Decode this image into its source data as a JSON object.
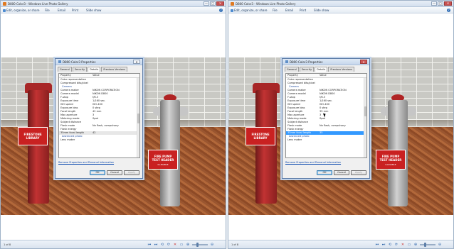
{
  "windows": [
    {
      "title": "D800 Color3 - Windows Live Photo Gallery",
      "menu": [
        "Edit, organize, or share",
        "File",
        "Email",
        "Print",
        "Slide show"
      ],
      "status_count": "1 of 8",
      "dialog": {
        "title": "D800 Color3 Properties",
        "tabs": [
          "General",
          "Security",
          "Details",
          "Previous Versions"
        ],
        "active_tab": "Details",
        "columns": [
          "Property",
          "Value"
        ],
        "rows": [
          {
            "p": "Color representation",
            "v": "",
            "type": "normal"
          },
          {
            "p": "Compressed bits/pixel",
            "v": "",
            "type": "normal"
          },
          {
            "p": "Camera",
            "v": "",
            "type": "section"
          },
          {
            "p": "Camera maker",
            "v": "NIKON CORPORATION",
            "type": "normal"
          },
          {
            "p": "Camera model",
            "v": "NIKON D800",
            "type": "normal"
          },
          {
            "p": "F-stop",
            "v": "f/6.3",
            "type": "normal"
          },
          {
            "p": "Exposure time",
            "v": "1/160 sec.",
            "type": "normal"
          },
          {
            "p": "ISO speed",
            "v": "ISO-400",
            "type": "normal"
          },
          {
            "p": "Exposure bias",
            "v": "0 step",
            "type": "normal"
          },
          {
            "p": "Focal length",
            "v": "42 mm",
            "type": "normal"
          },
          {
            "p": "Max aperture",
            "v": "3",
            "type": "normal"
          },
          {
            "p": "Metering mode",
            "v": "Spot",
            "type": "normal"
          },
          {
            "p": "Subject distance",
            "v": "",
            "type": "normal"
          },
          {
            "p": "Flash mode",
            "v": "No flash, compulsory",
            "type": "normal"
          },
          {
            "p": "Flash energy",
            "v": "",
            "type": "normal"
          },
          {
            "p": "35mm focal length",
            "v": "42",
            "type": "hl"
          },
          {
            "p": "Advanced photo",
            "v": "",
            "type": "section"
          },
          {
            "p": "Lens maker",
            "v": "",
            "type": "normal"
          }
        ],
        "link": "Remove Properties and Personal Information",
        "buttons": [
          "OK",
          "Cancel",
          "Apply"
        ]
      },
      "signs": {
        "left": [
          "FIRESTONE",
          "LIBRARY"
        ],
        "right": [
          "FIRE PUMP",
          "TEST HEADER"
        ],
        "right_small": "ILLEGIBLE"
      }
    },
    {
      "title": "D800 Color3 - Windows Live Photo Gallery",
      "menu": [
        "Edit, organize, or share",
        "File",
        "Email",
        "Print",
        "Slide show"
      ],
      "status_count": "1 of 8",
      "dialog": {
        "title": "D800 Color3 Properties",
        "tabs": [
          "General",
          "Security",
          "Details",
          "Previous Versions"
        ],
        "active_tab": "Details",
        "columns": [
          "Property",
          "Value"
        ],
        "rows": [
          {
            "p": "Color representation",
            "v": "",
            "type": "normal"
          },
          {
            "p": "Compressed bits/pixel",
            "v": "",
            "type": "normal"
          },
          {
            "p": "Camera",
            "v": "",
            "type": "section"
          },
          {
            "p": "Camera maker",
            "v": "NIKON CORPORATION",
            "type": "normal"
          },
          {
            "p": "Camera model",
            "v": "NIKON D800",
            "type": "normal"
          },
          {
            "p": "F-stop",
            "v": "f/6.3",
            "type": "normal"
          },
          {
            "p": "Exposure time",
            "v": "1/160 sec.",
            "type": "normal"
          },
          {
            "p": "ISO speed",
            "v": "ISO-400",
            "type": "normal"
          },
          {
            "p": "Exposure bias",
            "v": "0 step",
            "type": "normal"
          },
          {
            "p": "Focal length",
            "v": "35 mm",
            "type": "normal"
          },
          {
            "p": "Max aperture",
            "v": "3",
            "type": "normal"
          },
          {
            "p": "Metering mode",
            "v": "Spot",
            "type": "normal"
          },
          {
            "p": "Subject distance",
            "v": "",
            "type": "normal"
          },
          {
            "p": "Flash mode",
            "v": "No flash, compulsory",
            "type": "normal"
          },
          {
            "p": "Flash energy",
            "v": "",
            "type": "normal"
          },
          {
            "p": "35mm focal length",
            "v": "35",
            "type": "sel"
          },
          {
            "p": "Advanced photo",
            "v": "",
            "type": "section"
          },
          {
            "p": "Lens maker",
            "v": "",
            "type": "normal"
          }
        ],
        "link": "Remove Properties and Personal Information",
        "buttons": [
          "OK",
          "Cancel",
          "Apply"
        ]
      },
      "signs": {
        "left": [
          "FIRESTONE",
          "LIBRARY"
        ],
        "right": [
          "FIRE PUMP",
          "TEST HEADER"
        ],
        "right_small": "ILLEGIBLE"
      }
    }
  ],
  "window_buttons": [
    "—",
    "□",
    "✕"
  ],
  "toolbar_icons": [
    "⏮",
    "⏭",
    "⟲",
    "⟳",
    "✕",
    "▭",
    "⊕",
    "⊖"
  ],
  "accent": "#3399ff"
}
